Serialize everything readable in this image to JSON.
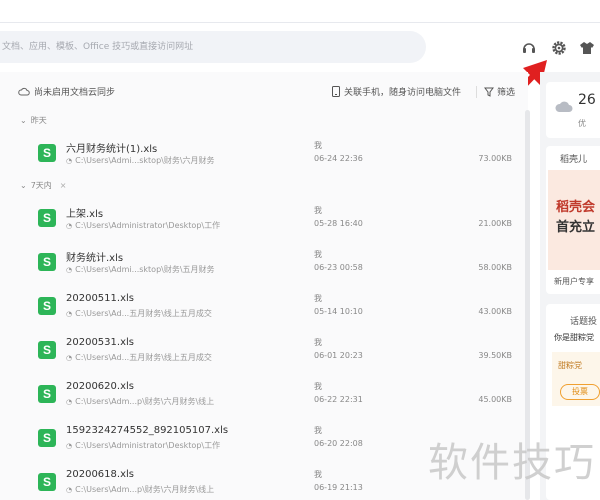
{
  "search": {
    "placeholder": "文档、应用、模板、Office 技巧或直接访问网址"
  },
  "toolbar": {
    "icons": [
      "headset-icon",
      "gear-icon",
      "skin-icon"
    ]
  },
  "subheader": {
    "sync_label": "尚未启用文档云同步",
    "phone_label": "关联手机，随身访问电脑文件",
    "filter_label": "筛选"
  },
  "groups": [
    {
      "label": "昨天",
      "files": [
        {
          "name": "六月财务统计(1).xls",
          "path": "C:\\Users\\Admi...sktop\\财务\\六月财务",
          "owner": "我",
          "date": "06-24 22:36",
          "size": "73.00KB"
        }
      ]
    },
    {
      "label": "7天内",
      "files": [
        {
          "name": "上架.xls",
          "path": "C:\\Users\\Administrator\\Desktop\\工作",
          "owner": "我",
          "date": "05-28 16:40",
          "size": "21.00KB"
        },
        {
          "name": "财务统计.xls",
          "path": "C:\\Users\\Admi...sktop\\财务\\五月财务",
          "owner": "我",
          "date": "06-23 00:58",
          "size": "58.00KB"
        },
        {
          "name": "20200511.xls",
          "path": "C:\\Users\\Ad...五月财务\\线上五月成交",
          "owner": "我",
          "date": "05-14 10:10",
          "size": "43.00KB"
        },
        {
          "name": "20200531.xls",
          "path": "C:\\Users\\Ad...五月财务\\线上五月成交",
          "owner": "我",
          "date": "06-01 20:23",
          "size": "39.50KB"
        },
        {
          "name": "20200620.xls",
          "path": "C:\\Users\\Adm...p\\财务\\六月财务\\线上",
          "owner": "我",
          "date": "06-22 22:31",
          "size": "45.00KB"
        },
        {
          "name": "1592324274552_892105107.xls",
          "path": "C:\\Users\\Administrator\\Desktop\\工作",
          "owner": "我",
          "date": "06-20 22:08",
          "size": ""
        },
        {
          "name": "20200618.xls",
          "path": "C:\\Users\\Adm...p\\财务\\六月财务\\线上",
          "owner": "我",
          "date": "06-19 21:13",
          "size": ""
        }
      ]
    }
  ],
  "right_panel": {
    "weather_temp": "26",
    "weather_desc": "优",
    "ad_label": "稻壳儿",
    "ad_title1": "稻壳会",
    "ad_title2": "首充立",
    "ad_foot": "新用户专享",
    "topic_label": "话题投",
    "topic_q": "你是甜粽党",
    "topic_option": "甜粽党",
    "vote_label": "投票"
  },
  "watermark": "软件技巧",
  "colors": {
    "xls_green": "#2db558",
    "accent_red": "#e02020"
  }
}
